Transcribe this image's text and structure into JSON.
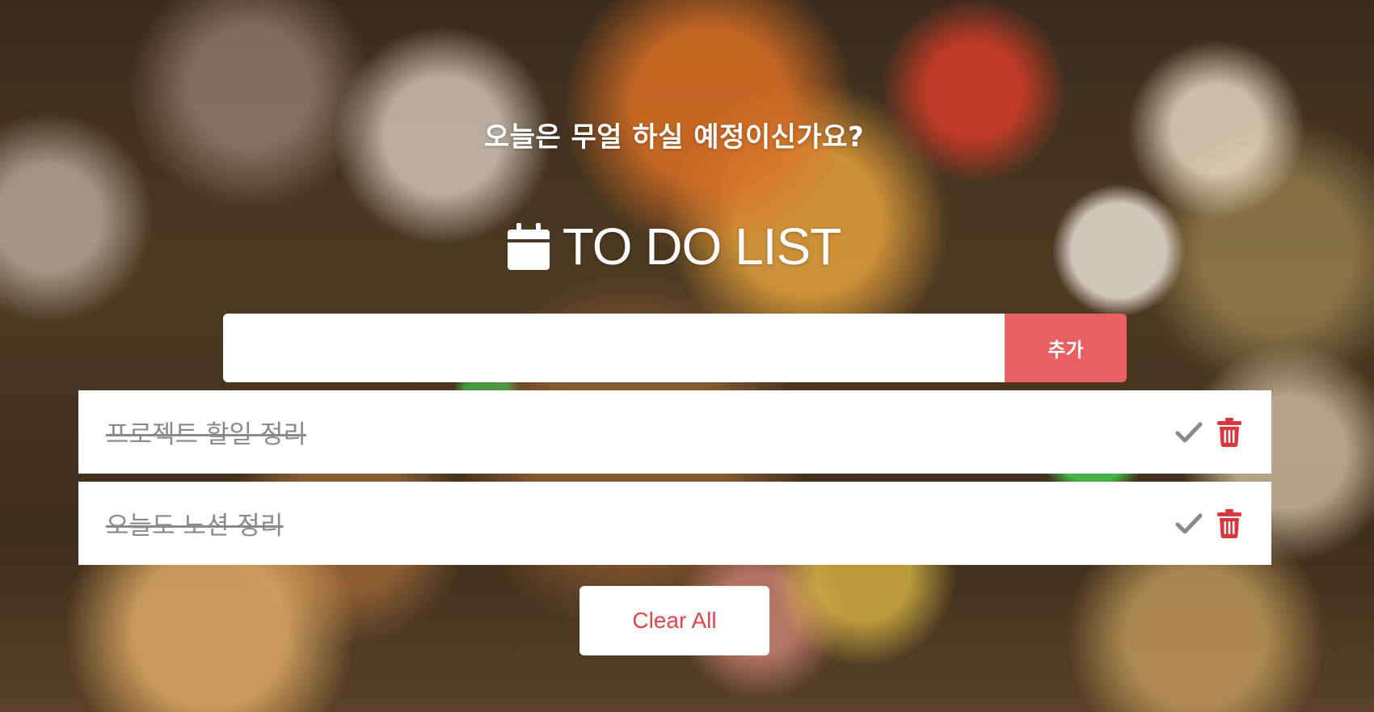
{
  "header": {
    "subtitle": "오늘은 무얼 하실 예정이신가요?",
    "title": "TO DO LIST",
    "title_icon": "calendar-icon"
  },
  "form": {
    "input_value": "",
    "input_placeholder": "",
    "add_label": "추가",
    "add_button_color": "#e86060"
  },
  "todos": [
    {
      "text": "프로젝트 할일 정리",
      "completed": true,
      "check_icon": "check-icon",
      "delete_icon": "trash-icon"
    },
    {
      "text": "오늘도 노션 정리",
      "completed": true,
      "check_icon": "check-icon",
      "delete_icon": "trash-icon"
    }
  ],
  "footer": {
    "clear_label": "Clear All",
    "clear_text_color": "#e0454a"
  },
  "colors": {
    "accent": "#e86060",
    "completed_text": "#8a8a8a",
    "check_icon": "#8a8a8a",
    "trash_icon": "#d9363e"
  }
}
